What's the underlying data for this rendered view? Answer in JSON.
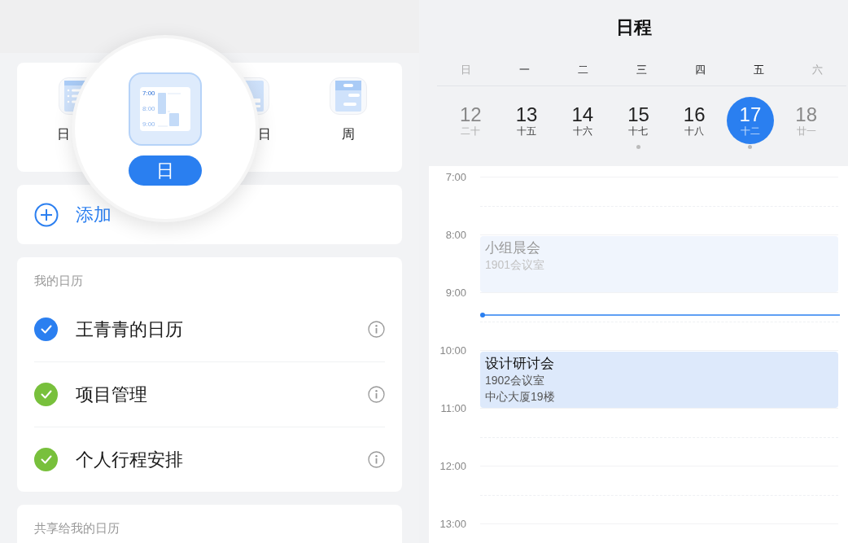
{
  "view_switcher": {
    "options": [
      {
        "kind": "list",
        "label": "日",
        "selected": false
      },
      {
        "kind": "hidden"
      },
      {
        "kind": "columns",
        "label": "日",
        "selected": false
      },
      {
        "kind": "week",
        "label": "周",
        "selected": false
      }
    ],
    "magnifier": {
      "label": "日",
      "selected": true,
      "icon_times": [
        "7:00",
        "8:00",
        "9:00"
      ]
    }
  },
  "add_calendar": {
    "label": "添加"
  },
  "my_calendars": {
    "title": "我的日历",
    "items": [
      {
        "name": "王青青的日历",
        "checked": true,
        "color": "#2b7ff0"
      },
      {
        "name": "项目管理",
        "checked": true,
        "color": "#78c03c"
      },
      {
        "name": "个人行程安排",
        "checked": true,
        "color": "#78c03c"
      }
    ]
  },
  "shared_calendars": {
    "title": "共享给我的日历"
  },
  "schedule": {
    "title": "日程",
    "weekdays": [
      {
        "label": "日",
        "weekend": true
      },
      {
        "label": "一",
        "weekend": false
      },
      {
        "label": "二",
        "weekend": false
      },
      {
        "label": "三",
        "weekend": false
      },
      {
        "label": "四",
        "weekend": false
      },
      {
        "label": "五",
        "weekend": false
      },
      {
        "label": "六",
        "weekend": true
      }
    ],
    "days": [
      {
        "date": "12",
        "lunar": "二十",
        "weekend": true,
        "selected": false,
        "has_events": false
      },
      {
        "date": "13",
        "lunar": "十五",
        "weekend": false,
        "selected": false,
        "has_events": false
      },
      {
        "date": "14",
        "lunar": "十六",
        "weekend": false,
        "selected": false,
        "has_events": false
      },
      {
        "date": "15",
        "lunar": "十七",
        "weekend": false,
        "selected": false,
        "has_events": true
      },
      {
        "date": "16",
        "lunar": "十八",
        "weekend": false,
        "selected": false,
        "has_events": false
      },
      {
        "date": "17",
        "lunar": "十二",
        "weekend": false,
        "selected": true,
        "has_events": true
      },
      {
        "date": "18",
        "lunar": "廿一",
        "weekend": true,
        "selected": false,
        "has_events": false
      }
    ],
    "hours": [
      {
        "label": "7:00",
        "now_marker": false
      },
      {
        "label": "8:00",
        "now_marker": false,
        "events": [
          {
            "title": "小组晨会",
            "details": [
              "1901会议室"
            ],
            "past": true
          }
        ]
      },
      {
        "label": "9:00",
        "now_marker": true
      },
      {
        "label": "10:00",
        "now_marker": false,
        "events": [
          {
            "title": "设计研讨会",
            "details": [
              "1902会议室",
              "中心大厦19楼"
            ],
            "past": false
          }
        ]
      },
      {
        "label": "11:00",
        "now_marker": false
      },
      {
        "label": "12:00",
        "now_marker": false
      },
      {
        "label": "13:00"
      }
    ]
  }
}
